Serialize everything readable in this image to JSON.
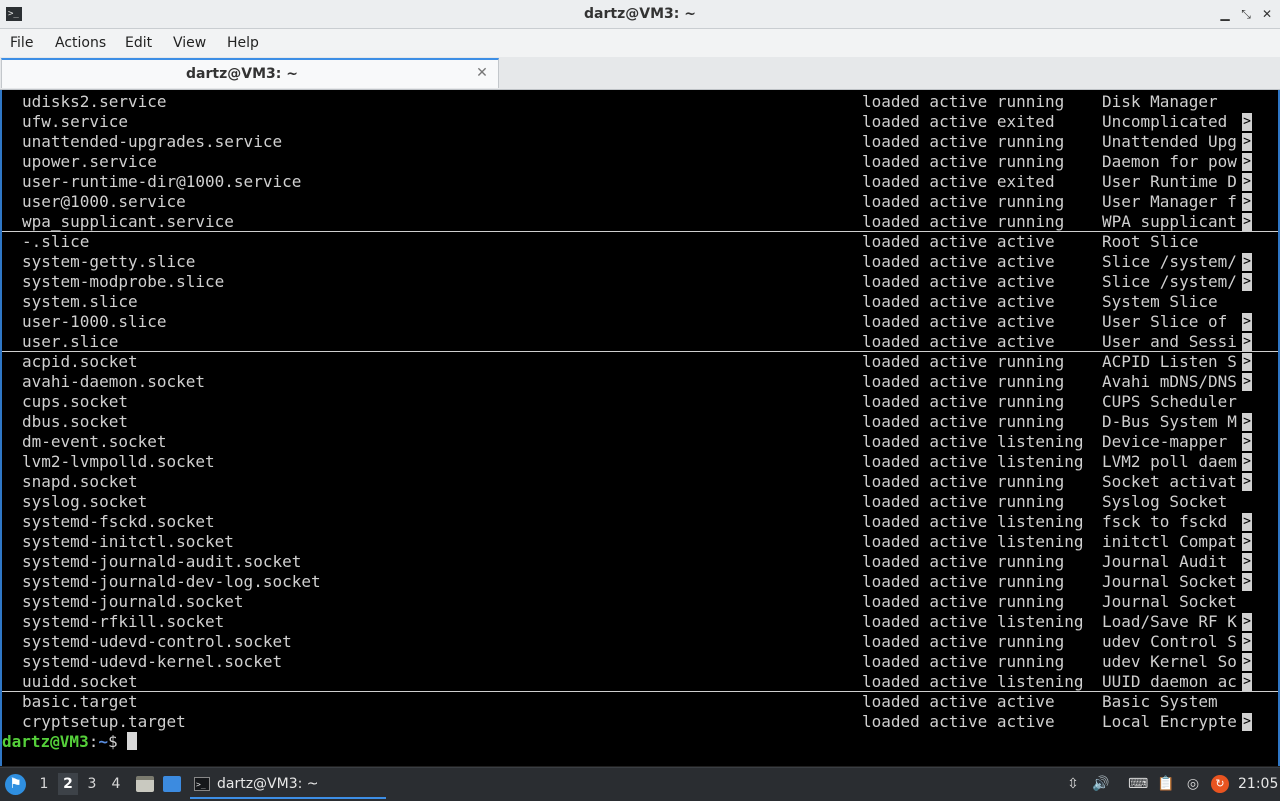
{
  "window": {
    "title": "dartz@VM3: ~",
    "app_icon": ">_",
    "minimize_icon": "▁",
    "maximize_icon": "⤡",
    "close_icon": "✕"
  },
  "menu": [
    "File",
    "Actions",
    "Edit",
    "View",
    "Help"
  ],
  "tab": {
    "label": "dartz@VM3: ~",
    "close": "✕"
  },
  "terminal": {
    "lines": [
      {
        "unit": "udisks2.service",
        "load": "loaded active running",
        "desc": "Disk Manager",
        "more": ""
      },
      {
        "unit": "ufw.service",
        "load": "loaded active exited",
        "desc": "Uncomplicated",
        "more": ">"
      },
      {
        "unit": "unattended-upgrades.service",
        "load": "loaded active running",
        "desc": "Unattended Upg",
        "more": ">"
      },
      {
        "unit": "upower.service",
        "load": "loaded active running",
        "desc": "Daemon for pow",
        "more": ">"
      },
      {
        "unit": "user-runtime-dir@1000.service",
        "load": "loaded active exited",
        "desc": "User Runtime D",
        "more": ">"
      },
      {
        "unit": "user@1000.service",
        "load": "loaded active running",
        "desc": "User Manager f",
        "more": ">"
      },
      {
        "unit": "wpa_supplicant.service",
        "load": "loaded active running",
        "desc": "WPA supplicant",
        "more": ">"
      },
      {
        "unit": "-.slice",
        "load": "loaded active active",
        "desc": "Root Slice",
        "more": ""
      },
      {
        "unit": "system-getty.slice",
        "load": "loaded active active",
        "desc": "Slice /system/",
        "more": ">"
      },
      {
        "unit": "system-modprobe.slice",
        "load": "loaded active active",
        "desc": "Slice /system/",
        "more": ">"
      },
      {
        "unit": "system.slice",
        "load": "loaded active active",
        "desc": "System Slice",
        "more": ""
      },
      {
        "unit": "user-1000.slice",
        "load": "loaded active active",
        "desc": "User Slice of",
        "more": ">"
      },
      {
        "unit": "user.slice",
        "load": "loaded active active",
        "desc": "User and Sessi",
        "more": ">"
      },
      {
        "unit": "acpid.socket",
        "load": "loaded active running",
        "desc": "ACPID Listen S",
        "more": ">"
      },
      {
        "unit": "avahi-daemon.socket",
        "load": "loaded active running",
        "desc": "Avahi mDNS/DNS",
        "more": ">"
      },
      {
        "unit": "cups.socket",
        "load": "loaded active running",
        "desc": "CUPS Scheduler",
        "more": ""
      },
      {
        "unit": "dbus.socket",
        "load": "loaded active running",
        "desc": "D-Bus System M",
        "more": ">"
      },
      {
        "unit": "dm-event.socket",
        "load": "loaded active listening",
        "desc": "Device-mapper",
        "more": ">"
      },
      {
        "unit": "lvm2-lvmpolld.socket",
        "load": "loaded active listening",
        "desc": "LVM2 poll daem",
        "more": ">"
      },
      {
        "unit": "snapd.socket",
        "load": "loaded active running",
        "desc": "Socket activat",
        "more": ">"
      },
      {
        "unit": "syslog.socket",
        "load": "loaded active running",
        "desc": "Syslog Socket",
        "more": ""
      },
      {
        "unit": "systemd-fsckd.socket",
        "load": "loaded active listening",
        "desc": "fsck to fsckd",
        "more": ">"
      },
      {
        "unit": "systemd-initctl.socket",
        "load": "loaded active listening",
        "desc": "initctl Compat",
        "more": ">"
      },
      {
        "unit": "systemd-journald-audit.socket",
        "load": "loaded active running",
        "desc": "Journal Audit",
        "more": ">"
      },
      {
        "unit": "systemd-journald-dev-log.socket",
        "load": "loaded active running",
        "desc": "Journal Socket",
        "more": ">"
      },
      {
        "unit": "systemd-journald.socket",
        "load": "loaded active running",
        "desc": "Journal Socket",
        "more": ""
      },
      {
        "unit": "systemd-rfkill.socket",
        "load": "loaded active listening",
        "desc": "Load/Save RF K",
        "more": ">"
      },
      {
        "unit": "systemd-udevd-control.socket",
        "load": "loaded active running",
        "desc": "udev Control S",
        "more": ">"
      },
      {
        "unit": "systemd-udevd-kernel.socket",
        "load": "loaded active running",
        "desc": "udev Kernel So",
        "more": ">"
      },
      {
        "unit": "uuidd.socket",
        "load": "loaded active listening",
        "desc": "UUID daemon ac",
        "more": ">"
      },
      {
        "unit": "basic.target",
        "load": "loaded active active",
        "desc": "Basic System",
        "more": ""
      },
      {
        "unit": "cryptsetup.target",
        "load": "loaded active active",
        "desc": "Local Encrypte",
        "more": ">"
      }
    ],
    "prompt": {
      "user_host": "dartz@VM3",
      "colon": ":",
      "path": "~",
      "symbol": "$ "
    }
  },
  "taskbar": {
    "start_icon": "⚑",
    "workspaces": [
      "1",
      "2",
      "3",
      "4"
    ],
    "active_workspace": "2",
    "task_label": "dartz@VM3: ~",
    "task_icon": ">_",
    "tray": {
      "scroll": "⇳",
      "volume": "🔊",
      "keyboard": "⌨",
      "clipboard": "📋",
      "steam": "◎",
      "updates": "↻"
    },
    "clock": "21:05"
  },
  "colors": {
    "terminal_bg": "#000000",
    "terminal_fg": "#d0d0d0",
    "prompt_user": "#55d03a",
    "prompt_path": "#5a8ee0",
    "accent": "#3d8ee5"
  }
}
